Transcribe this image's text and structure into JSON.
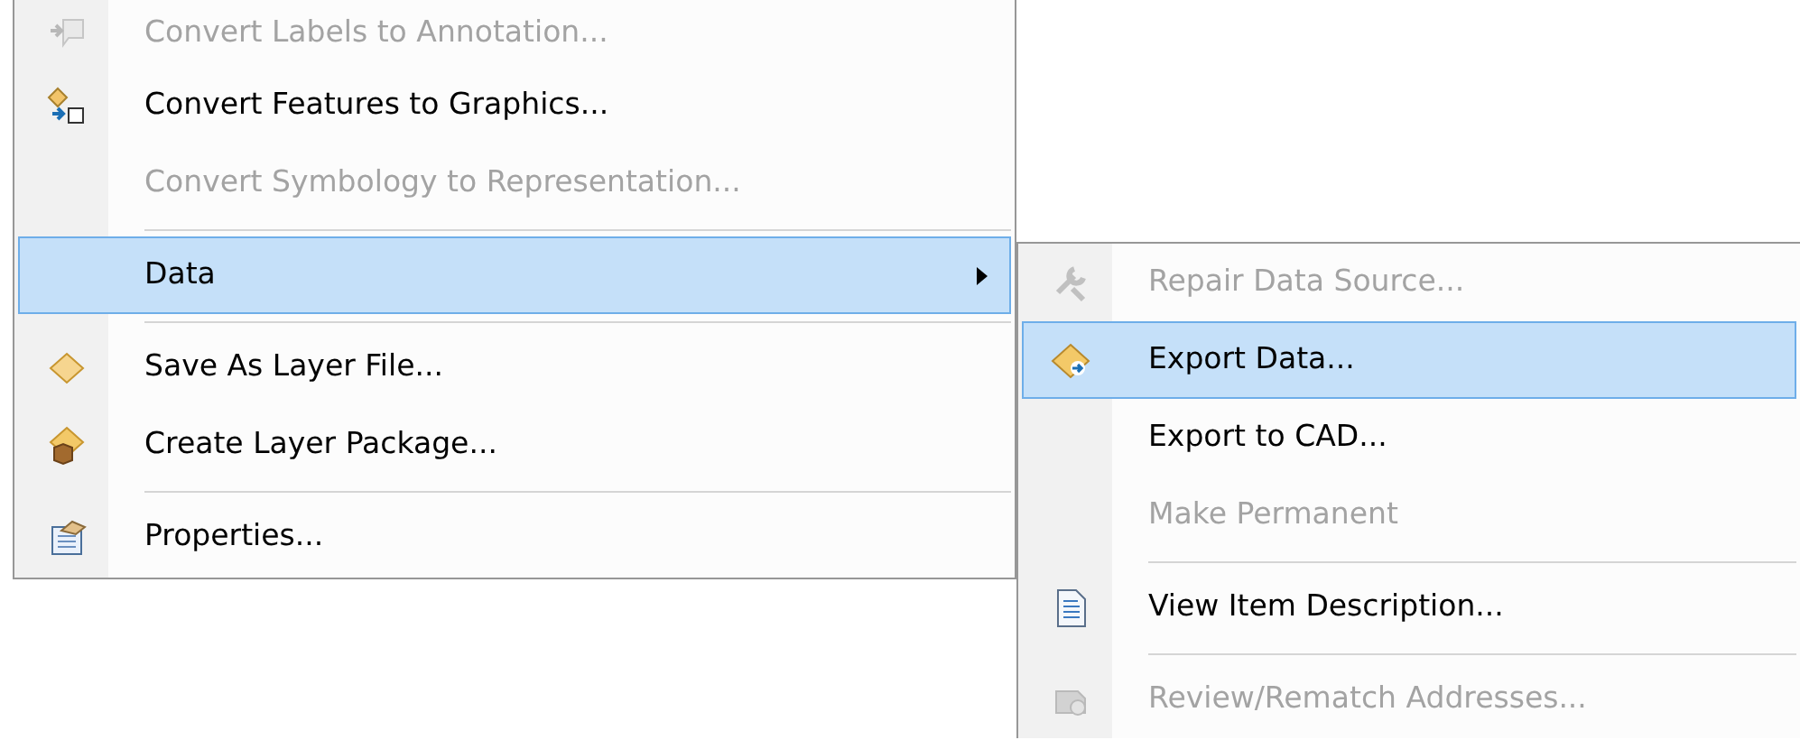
{
  "menu": {
    "items": [
      {
        "kind": "item",
        "label": "Convert Labels to Annotation...",
        "disabled": true,
        "selected": false
      },
      {
        "kind": "item",
        "label": "Convert Features to Graphics...",
        "disabled": false,
        "selected": false
      },
      {
        "kind": "item",
        "label": "Convert Symbology to Representation...",
        "disabled": true,
        "selected": false
      },
      {
        "kind": "separator"
      },
      {
        "kind": "submenu",
        "label": "Data",
        "disabled": false,
        "selected": true
      },
      {
        "kind": "separator"
      },
      {
        "kind": "item",
        "label": "Save As Layer File...",
        "disabled": false,
        "selected": false
      },
      {
        "kind": "item",
        "label": "Create Layer Package...",
        "disabled": false,
        "selected": false
      },
      {
        "kind": "separator"
      },
      {
        "kind": "item",
        "label": "Properties...",
        "disabled": false,
        "selected": false
      }
    ]
  },
  "submenu": {
    "items": [
      {
        "kind": "item",
        "label": "Repair Data Source...",
        "disabled": true,
        "selected": false
      },
      {
        "kind": "item",
        "label": "Export Data...",
        "disabled": false,
        "selected": true
      },
      {
        "kind": "item",
        "label": "Export to CAD...",
        "disabled": false,
        "selected": false
      },
      {
        "kind": "item",
        "label": "Make Permanent",
        "disabled": true,
        "selected": false
      },
      {
        "kind": "separator"
      },
      {
        "kind": "item",
        "label": "View Item Description...",
        "disabled": false,
        "selected": false
      },
      {
        "kind": "separator"
      },
      {
        "kind": "item",
        "label": "Review/Rematch Addresses...",
        "disabled": true,
        "selected": false
      }
    ]
  }
}
